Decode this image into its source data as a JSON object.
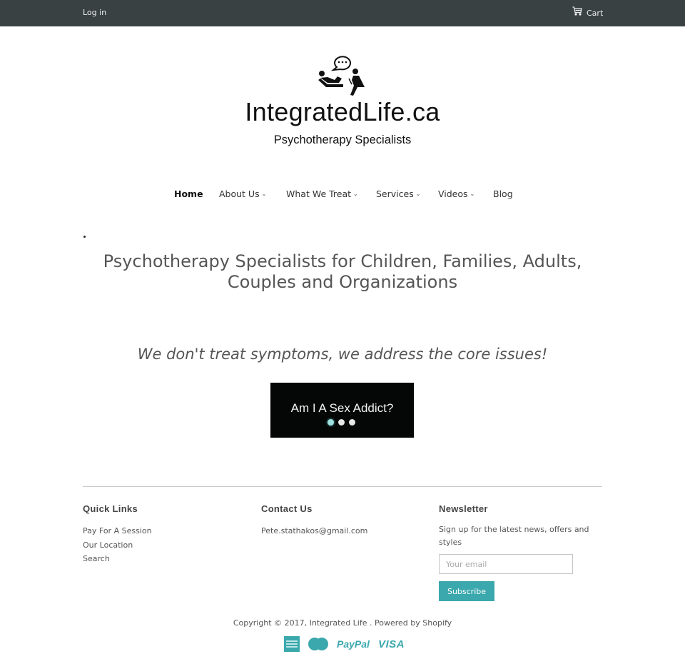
{
  "topbar": {
    "login_label": "Log in",
    "cart_label": "Cart",
    "cart_icon": "shopping-cart-icon"
  },
  "logo": {
    "icon": "therapy-session-icon",
    "title": "IntegratedLife.ca",
    "subtitle": "Psychotherapy Specialists"
  },
  "nav": {
    "items": [
      {
        "label": "Home",
        "active": true,
        "has_dropdown": false
      },
      {
        "label": "About Us",
        "active": false,
        "has_dropdown": true
      },
      {
        "label": "What We Treat",
        "active": false,
        "has_dropdown": true
      },
      {
        "label": "Services",
        "active": false,
        "has_dropdown": true
      },
      {
        "label": "Videos",
        "active": false,
        "has_dropdown": true
      },
      {
        "label": "Blog",
        "active": false,
        "has_dropdown": false
      }
    ],
    "chevron": "⌄"
  },
  "main": {
    "bullet": "•",
    "headline": "Psychotherapy Specialists for Children, Families, Adults, Couples and Organizations",
    "tagline": "We don't treat symptoms, we address the core issues!",
    "slideshow": {
      "text": "Am I A Sex Addict?",
      "slide_count": 3,
      "active_slide": 1
    }
  },
  "footer": {
    "quick_links": {
      "title": "Quick Links",
      "links": [
        "Pay For A Session",
        "Our Location",
        "Search"
      ]
    },
    "contact": {
      "title": "Contact Us",
      "email": "Pete.stathakos@gmail.com"
    },
    "newsletter": {
      "title": "Newsletter",
      "description": "Sign up for the latest news, offers and styles",
      "email_placeholder": "Your email",
      "email_value": "",
      "subscribe_label": "Subscribe"
    },
    "copyright": "Copyright © 2017, Integrated Life . Powered by Shopify",
    "payments": {
      "amex": "american-express-icon",
      "mastercard": "mastercard-icon",
      "paypal_label": "PayPal",
      "visa_label": "VISA"
    },
    "accent_color": "#3aa8ad"
  },
  "colors": {
    "topbar_bg": "#3a4143",
    "accent": "#3aa8ad"
  }
}
